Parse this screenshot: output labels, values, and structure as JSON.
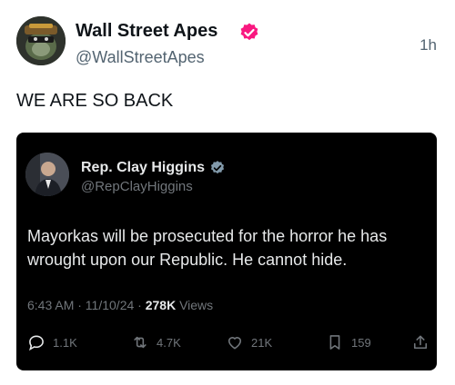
{
  "post": {
    "author_name": "Wall Street Apes",
    "author_handle": "@WallStreetApes",
    "time": "1h",
    "text": "WE ARE SO BACK",
    "verified_color": "#f91880"
  },
  "quoted": {
    "author_name": "Rep. Clay Higgins",
    "author_handle": "@RepClayHiggins",
    "verified_color": "#829aab",
    "text": "Mayorkas will be prosecuted for the horror he has wrought upon our Republic. He cannot hide.",
    "timestamp": "6:43 AM · 11/10/24 · ",
    "views_count": "278K",
    "views_label": " Views",
    "actions": {
      "replies": "1.1K",
      "reposts": "4.7K",
      "likes": "21K",
      "bookmarks": "159"
    }
  },
  "icons": [
    "verified-badge-icon",
    "reply-icon",
    "repost-icon",
    "like-icon",
    "bookmark-icon",
    "share-icon"
  ]
}
